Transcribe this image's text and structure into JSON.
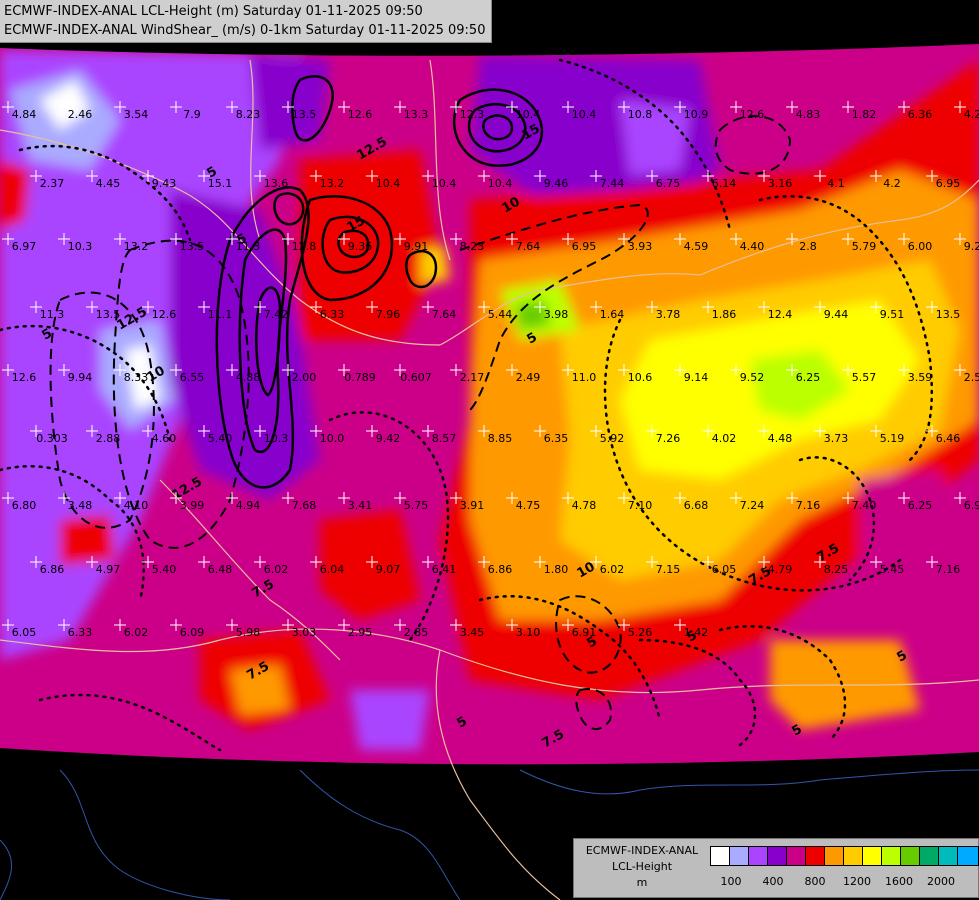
{
  "header": {
    "line1": "ECMWF-INDEX-ANAL LCL-Height (m) Saturday 01-11-2025 09:50",
    "line2": "ECMWF-INDEX-ANAL WindShear_ (m/s) 0-1km Saturday 01-11-2025 09:50"
  },
  "legend": {
    "title1": "ECMWF-INDEX-ANAL",
    "title2": "LCL-Height",
    "title3": "m",
    "colors": [
      "#ffffff",
      "#aaaaff",
      "#aa44ff",
      "#8800cc",
      "#cc0088",
      "#ee0000",
      "#ff9900",
      "#ffcc00",
      "#ffff00",
      "#bbff00",
      "#66cc00",
      "#00aa66",
      "#00bbbb",
      "#00aaff"
    ],
    "ticks": [
      "100",
      "400",
      "800",
      "1200",
      "1600",
      "2000"
    ]
  },
  "point_values": [
    "4.84",
    "2.46",
    "3.54",
    "7.9",
    "8.23",
    "13.5",
    "12.6",
    "13.3",
    "12.3",
    "10.4",
    "10.4",
    "10.8",
    "10.9",
    "12.6",
    "4.83",
    "1.82",
    "6.36",
    "4.20",
    "2.37",
    "4.45",
    "9.43",
    "15.1",
    "13.6",
    "13.2",
    "10.4",
    "10.4",
    "10.4",
    "9.46",
    "7.44",
    "6.75",
    "6.14",
    "3.16",
    "4.1",
    "4.2",
    "6.95",
    "6.97",
    "10.3",
    "13.2",
    "13.5",
    "11.3",
    "12.8",
    "9.36",
    "9.91",
    "8.23",
    "7.64",
    "6.95",
    "3.93",
    "4.59",
    "4.40",
    "2.8",
    "5.79",
    "6.00",
    "9.21",
    "11.3",
    "13.5",
    "12.6",
    "11.1",
    "7.42",
    "6.33",
    "7.96",
    "7.64",
    "5.44",
    "3.98",
    "1.64",
    "3.78",
    "1.86",
    "12.4",
    "9.44",
    "9.51",
    "13.5",
    "12.6",
    "9.94",
    "8.33",
    "6.55",
    "4.88",
    "2.00",
    "0.789",
    "0.607",
    "2.17",
    "2.49",
    "11.0",
    "10.6",
    "9.14",
    "9.52",
    "6.25",
    "5.57",
    "3.59",
    "2.52",
    "0.303",
    "2.88",
    "4.60",
    "5.40",
    "10.3",
    "10.0",
    "9.42",
    "8.57",
    "8.85",
    "6.35",
    "5.92",
    "7.26",
    "4.02",
    "4.48",
    "3.73",
    "5.19",
    "6.46",
    "6.80",
    "3.48",
    "4.10",
    "3.99",
    "4.94",
    "7.68",
    "3.41",
    "5.75",
    "3.91",
    "4.75",
    "4.78",
    "7.10",
    "6.68",
    "7.24",
    "7.16",
    "7.40",
    "6.25",
    "6.94",
    "6.86",
    "4.97",
    "5.40",
    "6.48",
    "6.02",
    "6.04",
    "9.07",
    "6.41",
    "6.86",
    "1.80",
    "6.02",
    "7.15",
    "6.05",
    "4.79",
    "8.25",
    "5.45",
    "7.16",
    "6.05",
    "6.33",
    "6.02",
    "6.09",
    "5.98",
    "3.03",
    "2.95",
    "2.85",
    "3.45",
    "3.10",
    "6.91",
    "5.26",
    "1.42"
  ],
  "contour_labels": [
    "12.5",
    "15",
    "10",
    "12.5",
    "10",
    "12.5",
    "15",
    "5",
    "7.5",
    "10",
    "5",
    "7.5",
    "5",
    "7.5",
    "5",
    "7.5",
    "5",
    "5",
    "7.5",
    "5",
    "5",
    "5"
  ]
}
